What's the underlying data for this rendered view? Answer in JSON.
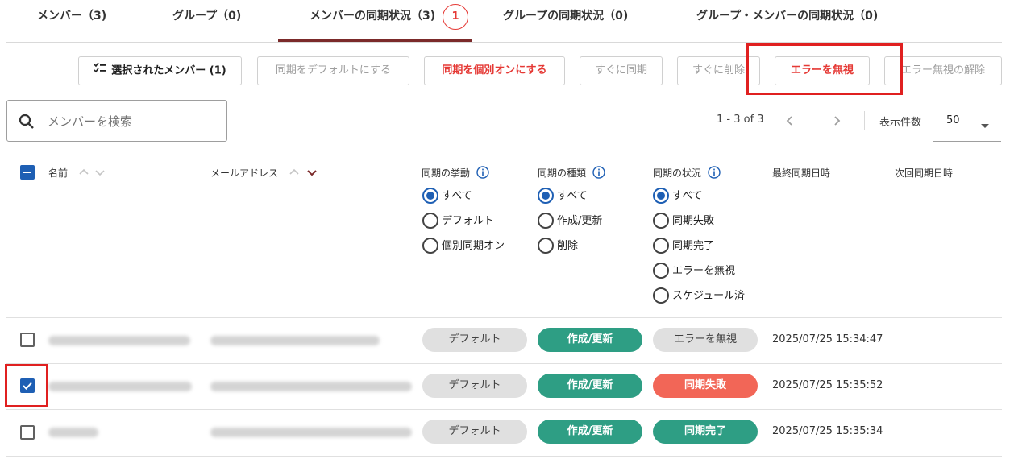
{
  "tabs": [
    {
      "label": "メンバー（3)"
    },
    {
      "label": "グループ（0)"
    },
    {
      "label": "メンバーの同期状況（3)"
    },
    {
      "label": "グループの同期状況（0)"
    },
    {
      "label": "グループ・メンバーの同期状況（0)"
    }
  ],
  "tab_badge": "1",
  "toolbar": {
    "selected_members": "選択されたメンバー (1)",
    "set_default": "同期をデフォルトにする",
    "set_individual_on": "同期を個別オンにする",
    "sync_now": "すぐに同期",
    "delete_now": "すぐに削除",
    "ignore_error": "エラーを無視",
    "unignore_error": "エラー無視の解除"
  },
  "search": {
    "placeholder": "メンバーを検索"
  },
  "pagination": {
    "range": "1 - 3 of 3",
    "per_page_label": "表示件数",
    "per_page": "50"
  },
  "columns": {
    "name": "名前",
    "email": "メールアドレス",
    "sync_behavior": "同期の挙動",
    "sync_type": "同期の種類",
    "sync_status": "同期の状況",
    "last_sync": "最終同期日時",
    "next_sync": "次回同期日時"
  },
  "filters": {
    "behavior": [
      "すべて",
      "デフォルト",
      "個別同期オン"
    ],
    "type": [
      "すべて",
      "作成/更新",
      "削除"
    ],
    "status": [
      "すべて",
      "同期失敗",
      "同期完了",
      "エラーを無視",
      "スケジュール済"
    ]
  },
  "rows": [
    {
      "behavior": "デフォルト",
      "type": "作成/更新",
      "status": "エラーを無視",
      "last_sync": "2025/07/25 15:34:47",
      "checked": false
    },
    {
      "behavior": "デフォルト",
      "type": "作成/更新",
      "status": "同期失敗",
      "last_sync": "2025/07/25 15:35:52",
      "checked": true
    },
    {
      "behavior": "デフォルト",
      "type": "作成/更新",
      "status": "同期完了",
      "last_sync": "2025/07/25 15:35:34",
      "checked": false
    }
  ],
  "colors": {
    "accent": "#1e5fb4",
    "tab_indicator": "#7b2a2a",
    "success": "#2e9e84",
    "error": "#f26657",
    "highlight": "#e02020"
  }
}
